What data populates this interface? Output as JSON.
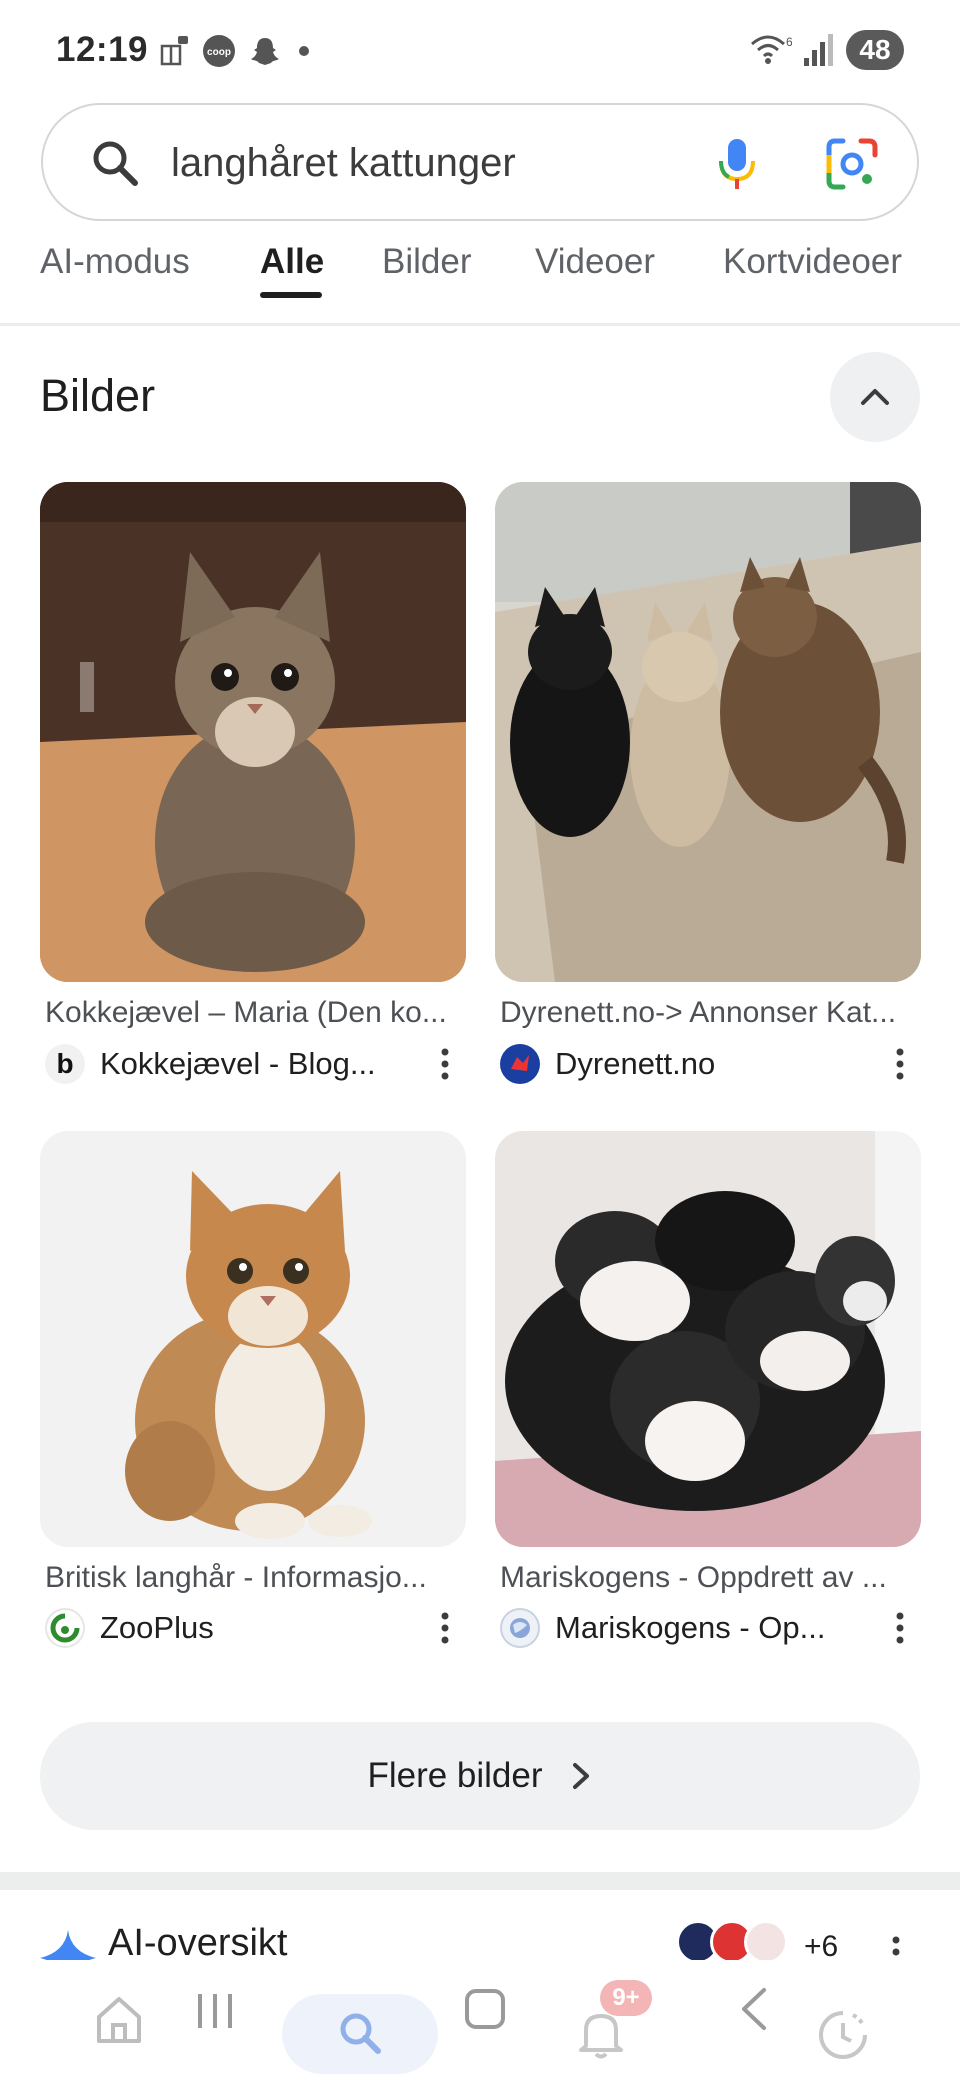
{
  "status_bar": {
    "time": "12:19",
    "battery": "48",
    "left_icons": [
      "gift-icon",
      "coop-icon",
      "snapchat-icon",
      "dot-icon"
    ],
    "right_icons": [
      "wifi-icon",
      "signal-icon",
      "battery-icon"
    ]
  },
  "search": {
    "query": "langhåret kattunger"
  },
  "tabs": [
    {
      "label": "AI-modus",
      "active": false
    },
    {
      "label": "Alle",
      "active": true
    },
    {
      "label": "Bilder",
      "active": false
    },
    {
      "label": "Videoer",
      "active": false
    },
    {
      "label": "Kortvideoer",
      "active": false
    }
  ],
  "images_section": {
    "title": "Bilder",
    "results": [
      {
        "caption": "Kokkejævel – Maria (Den ko...",
        "source": "Kokkejævel - Blog...",
        "favicon_letter": "b"
      },
      {
        "caption": "Dyrenett.no-> Annonser Kat...",
        "source": "Dyrenett.no"
      },
      {
        "caption": "Britisk langhår - Informasjo...",
        "source": "ZooPlus"
      },
      {
        "caption": "Mariskogens - Oppdrett av ...",
        "source": "Mariskogens - Op..."
      }
    ],
    "more_button": "Flere bilder"
  },
  "ai_overview": {
    "label": "AI-oversikt",
    "extra_count": "+6"
  },
  "bottom_nav": {
    "notification_badge": "9+",
    "items": [
      "home-icon",
      "recents-icon",
      "search-icon",
      "overview-icon",
      "notifications-icon",
      "back-icon",
      "activity-icon"
    ]
  },
  "colors": {
    "google_blue": "#4285F4",
    "google_red": "#EA4335",
    "google_yellow": "#FBBC05",
    "google_green": "#34A853",
    "text_primary": "#1f1f1f",
    "text_secondary": "#5f6368"
  }
}
